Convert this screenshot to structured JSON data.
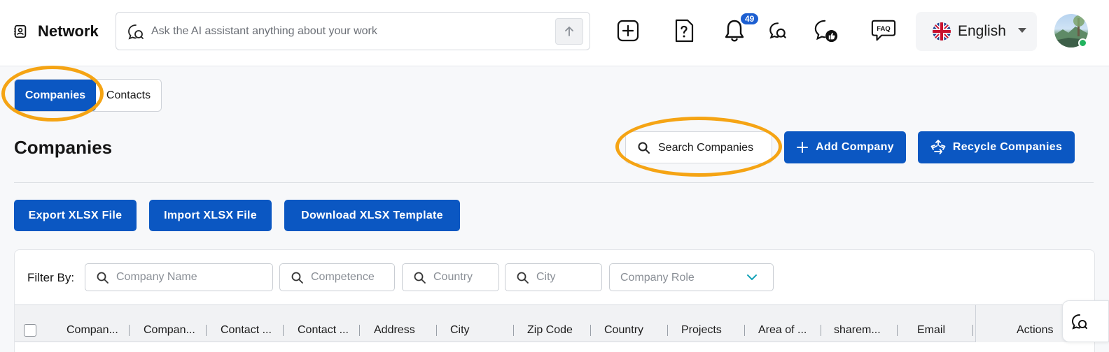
{
  "brand": {
    "name": "Network",
    "icon": "address-book-icon"
  },
  "ai_search": {
    "placeholder": "Ask the AI assistant anything about your work",
    "send_icon": "arrow-up-icon"
  },
  "toolbar": {
    "icons": [
      "plus-square-icon",
      "help-document-icon",
      "bell-icon",
      "chat-bubble-icon",
      "chat-like-icon",
      "faq-icon"
    ],
    "notifications_count": "49",
    "faq_label": "FAQ"
  },
  "language": {
    "label": "English",
    "flag": "uk-flag-icon"
  },
  "user": {
    "status_color": "#22b35e"
  },
  "tabs": [
    {
      "label": "Companies",
      "active": true
    },
    {
      "label": "Contacts",
      "active": false
    }
  ],
  "page": {
    "title": "Companies"
  },
  "actions": {
    "search_label": "Search Companies",
    "add_label": "Add Company",
    "recycle_label": "Recycle Companies"
  },
  "file_actions": {
    "export_label": "Export XLSX File",
    "import_label": "Import XLSX File",
    "template_label": "Download XLSX Template"
  },
  "filters": {
    "label": "Filter By:",
    "company_name_placeholder": "Company Name",
    "competence_placeholder": "Competence",
    "country_placeholder": "Country",
    "city_placeholder": "City",
    "company_role_placeholder": "Company Role"
  },
  "table": {
    "columns": [
      "Compan...",
      "Compan...",
      "Contact ...",
      "Contact ...",
      "Address",
      "City",
      "Zip Code",
      "Country",
      "Projects",
      "Area of ...",
      "sharem...",
      "Email"
    ],
    "actions_header": "Actions"
  },
  "colors": {
    "primary": "#0b57c2",
    "highlight": "#f5a414",
    "badge": "#1d5fd1"
  }
}
